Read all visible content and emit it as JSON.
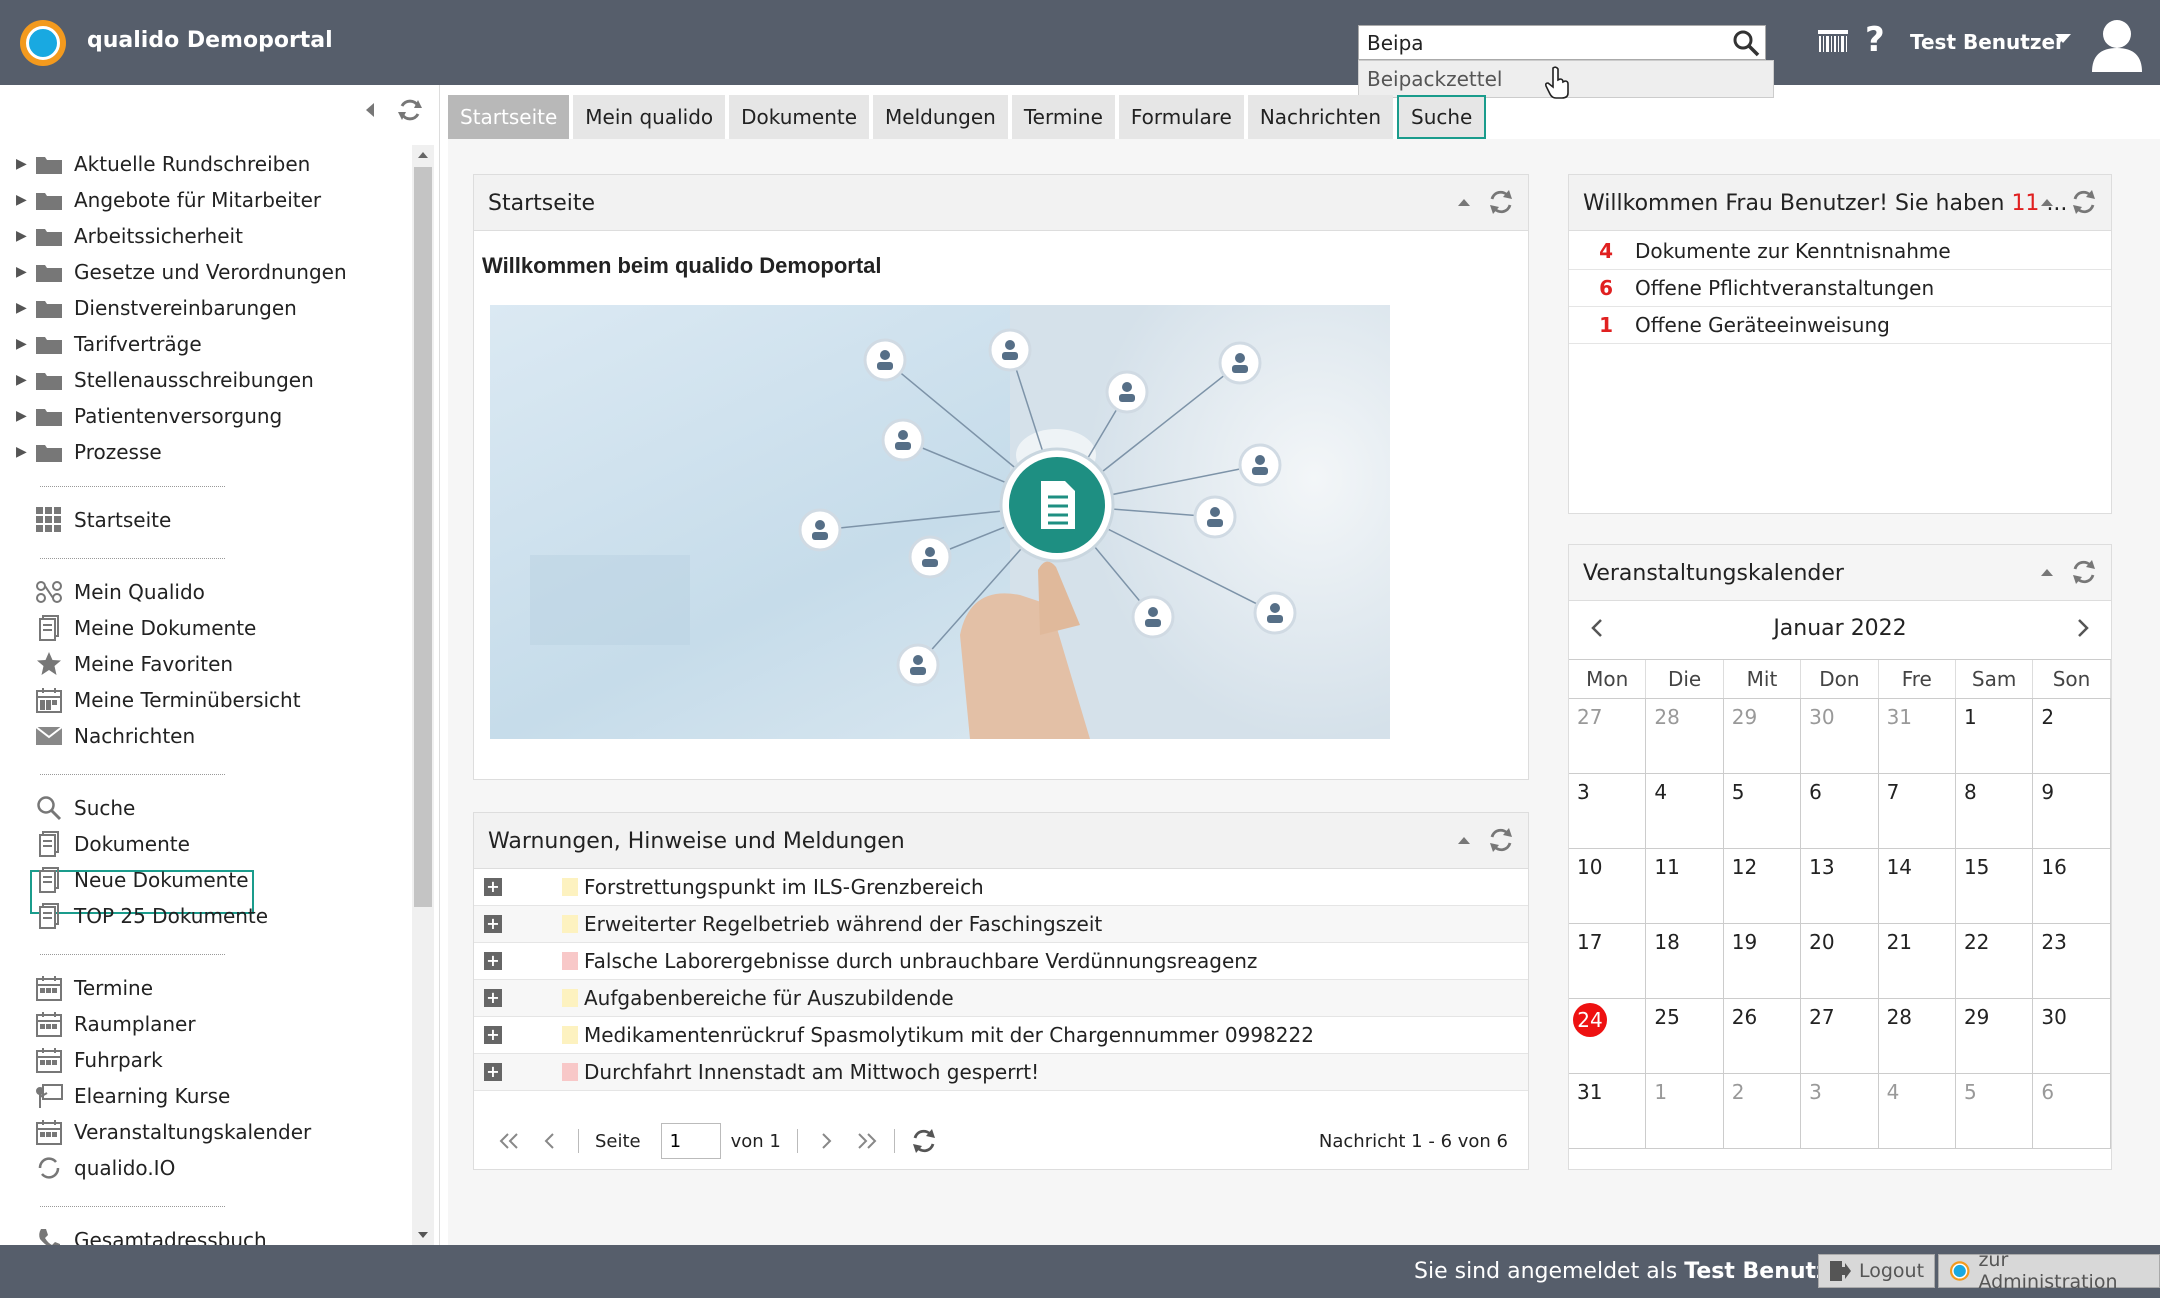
{
  "header": {
    "title": "qualido Demoportal",
    "search_value": "Beipa",
    "suggestion": "Beipackzettel",
    "user_name": "Test Benutzer"
  },
  "sidebar": {
    "folders": [
      "Aktuelle Rundschreiben",
      "Angebote für Mitarbeiter",
      "Arbeitssicherheit",
      "Gesetze und Verordnungen",
      "Dienstvereinbarungen",
      "Tarifverträge",
      "Stellenausschreibungen",
      "Patientenversorgung",
      "Prozesse"
    ],
    "start": "Startseite",
    "personal": [
      "Mein Qualido",
      "Meine Dokumente",
      "Meine Favoriten",
      "Meine Terminübersicht",
      "Nachrichten"
    ],
    "search_group": [
      "Suche",
      "Dokumente",
      "Neue Dokumente",
      "TOP 25 Dokumente"
    ],
    "calendar_group": [
      "Termine",
      "Raumplaner",
      "Fuhrpark",
      "Elearning Kurse",
      "Veranstaltungskalender",
      "qualido.IO"
    ],
    "address": "Gesamtadressbuch"
  },
  "tabs": [
    "Startseite",
    "Mein qualido",
    "Dokumente",
    "Meldungen",
    "Termine",
    "Formulare",
    "Nachrichten",
    "Suche"
  ],
  "start_panel": {
    "title": "Startseite",
    "welcome": "Willkommen beim qualido Demoportal"
  },
  "warnings_panel": {
    "title": "Warnungen, Hinweise und Meldungen",
    "rows": [
      {
        "text": "Forstrettungspunkt im ILS-Grenzbereich",
        "color": "#fdf2c0"
      },
      {
        "text": "Erweiterter Regelbetrieb während der Faschingszeit",
        "color": "#fdf2c0"
      },
      {
        "text": "Falsche Laborergebnisse durch unbrauchbare Verdünnungsreagenz",
        "color": "#f8c8c8"
      },
      {
        "text": "Aufgabenbereiche für Auszubildende",
        "color": "#fdf2c0"
      },
      {
        "text": "Medikamentenrückruf Spasmolytikum mit der Chargennummer 0998222",
        "color": "#fdf2c0"
      },
      {
        "text": "Durchfahrt Innenstadt am Mittwoch gesperrt!",
        "color": "#f8c8c8"
      }
    ],
    "pager": {
      "seite_label": "Seite",
      "page": "1",
      "of_label": "von 1",
      "summary": "Nachricht 1 - 6 von 6"
    }
  },
  "summary_panel": {
    "title_prefix": "Willkommen Frau Benutzer! Sie haben",
    "title_count": "11",
    "title_suffix": "...",
    "rows": [
      {
        "count": "4",
        "label": "Dokumente zur Kenntnisnahme"
      },
      {
        "count": "6",
        "label": "Offene Pflichtveranstaltungen"
      },
      {
        "count": "1",
        "label": "Offene Geräteeinweisung"
      }
    ]
  },
  "calendar_panel": {
    "title": "Veranstaltungskalender",
    "month": "Januar 2022",
    "weekdays": [
      "Mon",
      "Die",
      "Mit",
      "Don",
      "Fre",
      "Sam",
      "Son"
    ],
    "days": [
      {
        "d": "27",
        "m": true
      },
      {
        "d": "28",
        "m": true
      },
      {
        "d": "29",
        "m": true
      },
      {
        "d": "30",
        "m": true
      },
      {
        "d": "31",
        "m": true
      },
      {
        "d": "1"
      },
      {
        "d": "2"
      },
      {
        "d": "3"
      },
      {
        "d": "4"
      },
      {
        "d": "5"
      },
      {
        "d": "6"
      },
      {
        "d": "7"
      },
      {
        "d": "8"
      },
      {
        "d": "9"
      },
      {
        "d": "10"
      },
      {
        "d": "11"
      },
      {
        "d": "12"
      },
      {
        "d": "13"
      },
      {
        "d": "14"
      },
      {
        "d": "15"
      },
      {
        "d": "16"
      },
      {
        "d": "17"
      },
      {
        "d": "18"
      },
      {
        "d": "19"
      },
      {
        "d": "20"
      },
      {
        "d": "21"
      },
      {
        "d": "22"
      },
      {
        "d": "23"
      },
      {
        "d": "24",
        "today": true
      },
      {
        "d": "25"
      },
      {
        "d": "26"
      },
      {
        "d": "27"
      },
      {
        "d": "28"
      },
      {
        "d": "29"
      },
      {
        "d": "30"
      },
      {
        "d": "31"
      },
      {
        "d": "1",
        "m": true
      },
      {
        "d": "2",
        "m": true
      },
      {
        "d": "3",
        "m": true
      },
      {
        "d": "4",
        "m": true
      },
      {
        "d": "5",
        "m": true
      },
      {
        "d": "6",
        "m": true
      }
    ]
  },
  "footer": {
    "prefix": "Sie sind angemeldet als",
    "user": "Test Benutzer",
    "logout": "Logout",
    "admin": "zur Administration"
  },
  "colors": {
    "header": "#565e6b",
    "accent": "#1a9c8c",
    "badge": "#e02020"
  }
}
